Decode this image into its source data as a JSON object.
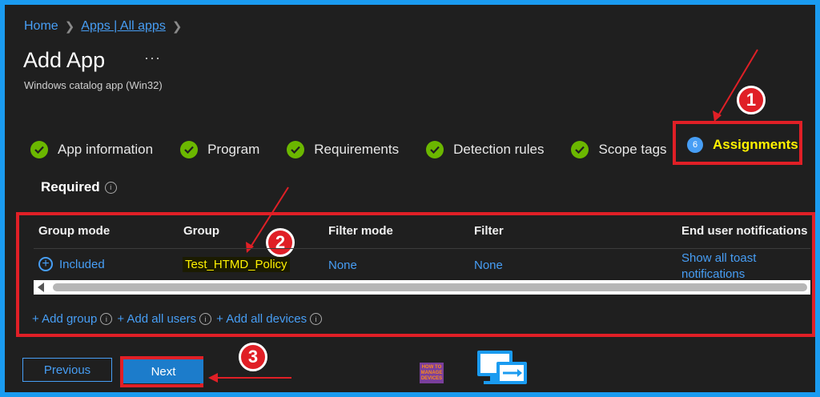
{
  "breadcrumb": {
    "home": "Home",
    "apps": "Apps | All apps"
  },
  "page": {
    "title": "Add App",
    "more": "···",
    "subtitle": "Windows catalog app (Win32)"
  },
  "steps": [
    {
      "label": "App information",
      "status": "complete"
    },
    {
      "label": "Program",
      "status": "complete"
    },
    {
      "label": "Requirements",
      "status": "complete"
    },
    {
      "label": "Detection rules",
      "status": "complete"
    },
    {
      "label": "Scope tags",
      "status": "complete"
    },
    {
      "number": "6",
      "label": "Assignments",
      "status": "active"
    }
  ],
  "section": {
    "title": "Required"
  },
  "table": {
    "headers": [
      "Group mode",
      "Group",
      "Filter mode",
      "Filter",
      "End user notifications"
    ],
    "row": {
      "group_mode": "Included",
      "group": "Test_HTMD_Policy",
      "filter_mode": "None",
      "filter": "None",
      "notifications_line1": "Show all toast",
      "notifications_line2": "notifications"
    }
  },
  "actions": {
    "add_group": "+ Add group",
    "add_all_users": "+ Add all users",
    "add_all_devices": "+ Add all devices"
  },
  "buttons": {
    "previous": "Previous",
    "next": "Next"
  },
  "callouts": [
    "1",
    "2",
    "3"
  ],
  "logo": {
    "htmd": "HOW TO MANAGE DEVICES"
  },
  "colors": {
    "accent": "#479ef5",
    "success": "#6bb700",
    "highlight_border": "#e01f26",
    "active_step_text": "#fff200",
    "page_border": "#1a9bf0"
  }
}
